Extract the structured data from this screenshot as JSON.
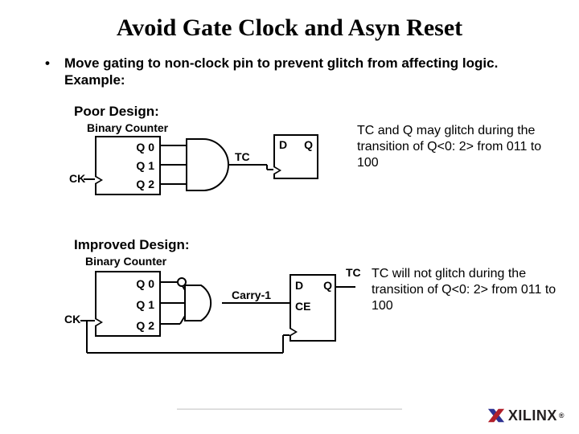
{
  "title": "Avoid Gate Clock and Asyn Reset",
  "bullet": "Move gating to non-clock pin to prevent glitch from affecting logic. Example:",
  "poor": {
    "heading": "Poor Design:",
    "counter_label": "Binary Counter",
    "ck": "CK",
    "q0": "Q 0",
    "q1": "Q 1",
    "q2": "Q 2",
    "tc": "TC",
    "d": "D",
    "q": "Q",
    "note": "TC and Q may glitch during the transition of Q<0: 2> from 011 to 100"
  },
  "improved": {
    "heading": "Improved Design:",
    "counter_label": "Binary Counter",
    "ck": "CK",
    "q0": "Q 0",
    "q1": "Q 1",
    "q2": "Q 2",
    "carry": "Carry-1",
    "d": "D",
    "q": "Q",
    "ce": "CE",
    "tc": "TC",
    "note": "TC will not glitch during the transition of Q<0: 2> from 011 to 100"
  },
  "logo": {
    "text": "XILINX",
    "reg": "®"
  }
}
